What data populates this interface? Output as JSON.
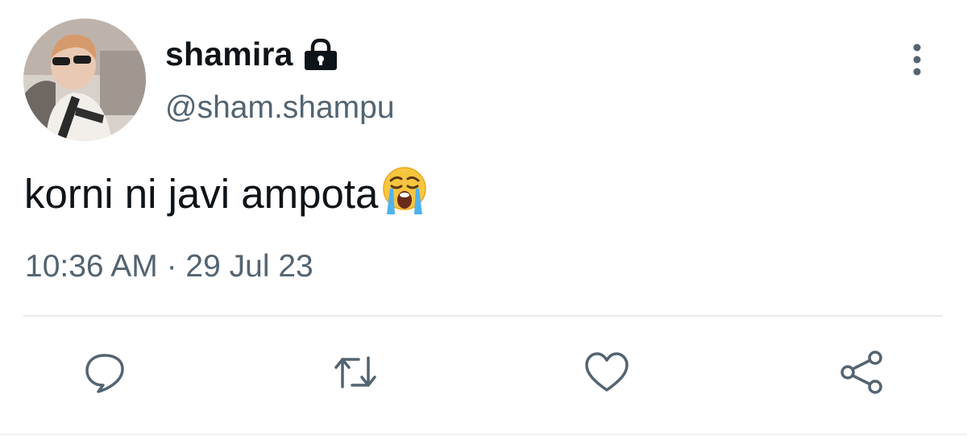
{
  "user": {
    "display_name": "shamira",
    "handle": "@sham.shampu",
    "protected": true
  },
  "tweet": {
    "text": "korni ni javi ampota",
    "emoji": "loudly-crying-face",
    "timestamp": "10:36 AM · 29 Jul 23"
  },
  "actions": [
    "reply",
    "retweet",
    "like",
    "share"
  ],
  "icons": {
    "more": "more-vertical-icon",
    "lock": "lock-icon"
  },
  "colors": {
    "text": "#0f1419",
    "secondary": "#536471",
    "divider": "#e7eaed"
  }
}
